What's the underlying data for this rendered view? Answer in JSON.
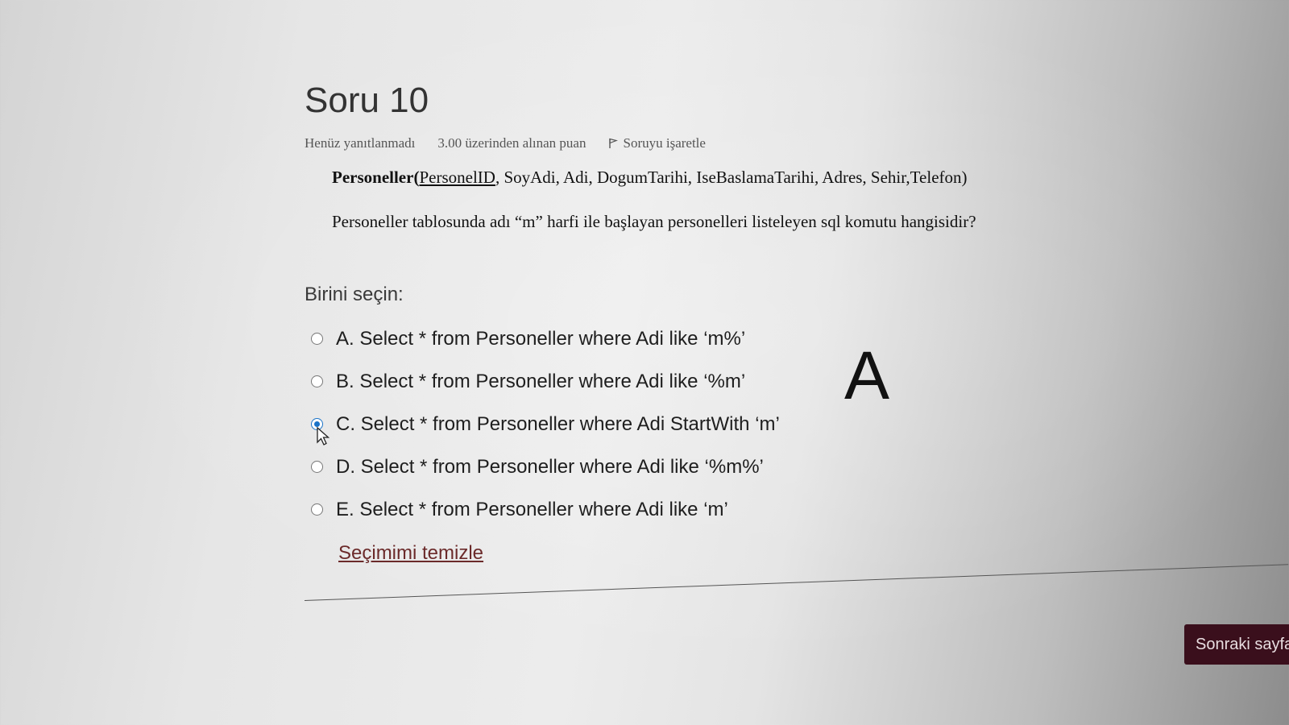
{
  "question": {
    "title": "Soru 10",
    "status": "Henüz yanıtlanmadı",
    "points": "3.00 üzerinden alınan puan",
    "flag_label": "Soruyu işaretle",
    "schema_table": "Personeller(",
    "schema_pk": "PersonelID",
    "schema_rest": ", SoyAdi, Adi, DogumTarihi, IseBaslamaTarihi, Adres, Sehir,Telefon)",
    "prompt": "Personeller tablosunda adı “m” harfi ile başlayan personelleri listeleyen sql komutu hangisidir?",
    "choose_label": "Birini seçin:",
    "options": [
      {
        "label": "A. Select * from Personeller where Adi like ‘m%’",
        "selected": false
      },
      {
        "label": "B. Select * from Personeller where Adi like ‘%m’",
        "selected": false
      },
      {
        "label": "C. Select * from Personeller where Adi StartWith ‘m’",
        "selected": true
      },
      {
        "label": "D. Select * from Personeller where Adi like ‘%m%’",
        "selected": false
      },
      {
        "label": "E. Select * from Personeller where Adi like ‘m’",
        "selected": false
      }
    ],
    "clear_label": "Seçimimi temizle"
  },
  "annotation": "A",
  "navigation": {
    "next_label": "Sonraki sayfa"
  },
  "colors": {
    "selected_radio": "#1a73c8",
    "next_button": "#3a0f1c",
    "link": "#6b2a2a"
  }
}
